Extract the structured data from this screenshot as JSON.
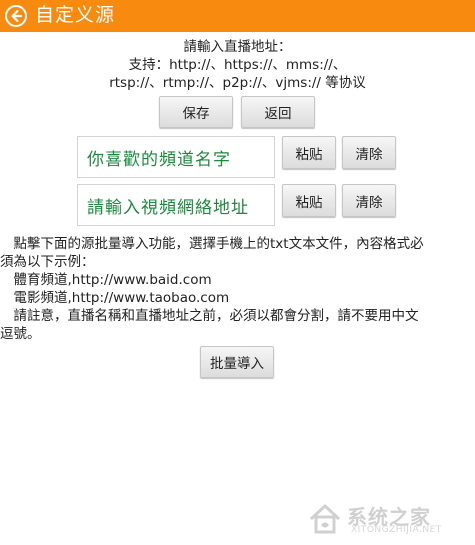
{
  "header": {
    "title": "自定义源",
    "back_icon": "arrow-left-circle-icon",
    "bg_color": "#f88a10"
  },
  "info": {
    "line1": "請輸入直播地址：",
    "line2": "支持：http://、https://、mms://、",
    "line3": "rtsp://、rtmp://、p2p://、vjms:// 等协议"
  },
  "actions": {
    "save_label": "保存",
    "back_label": "返回"
  },
  "channel_name": {
    "placeholder": "你喜歡的頻道名字",
    "paste_label": "粘贴",
    "clear_label": "清除"
  },
  "channel_url": {
    "placeholder": "請輸入視頻網絡地址",
    "paste_label": "粘贴",
    "clear_label": "清除"
  },
  "instructions": {
    "line1": "　點擊下面的源批量導入功能，選擇手機上的txt文本文件，內容格式必",
    "line2": "須為以下示例：",
    "line3": "　體育頻道,http://www.baid.com",
    "line4": "　電影頻道,http://www.taobao.com",
    "line5": "　請註意，直播名稱和直播地址之前，必須以都會分割，請不要用中文",
    "line6": "逗號。"
  },
  "batch_import_label": "批量導入",
  "watermark": {
    "text": "系统之家",
    "sub": "XITONGZHIJIA.NET"
  }
}
